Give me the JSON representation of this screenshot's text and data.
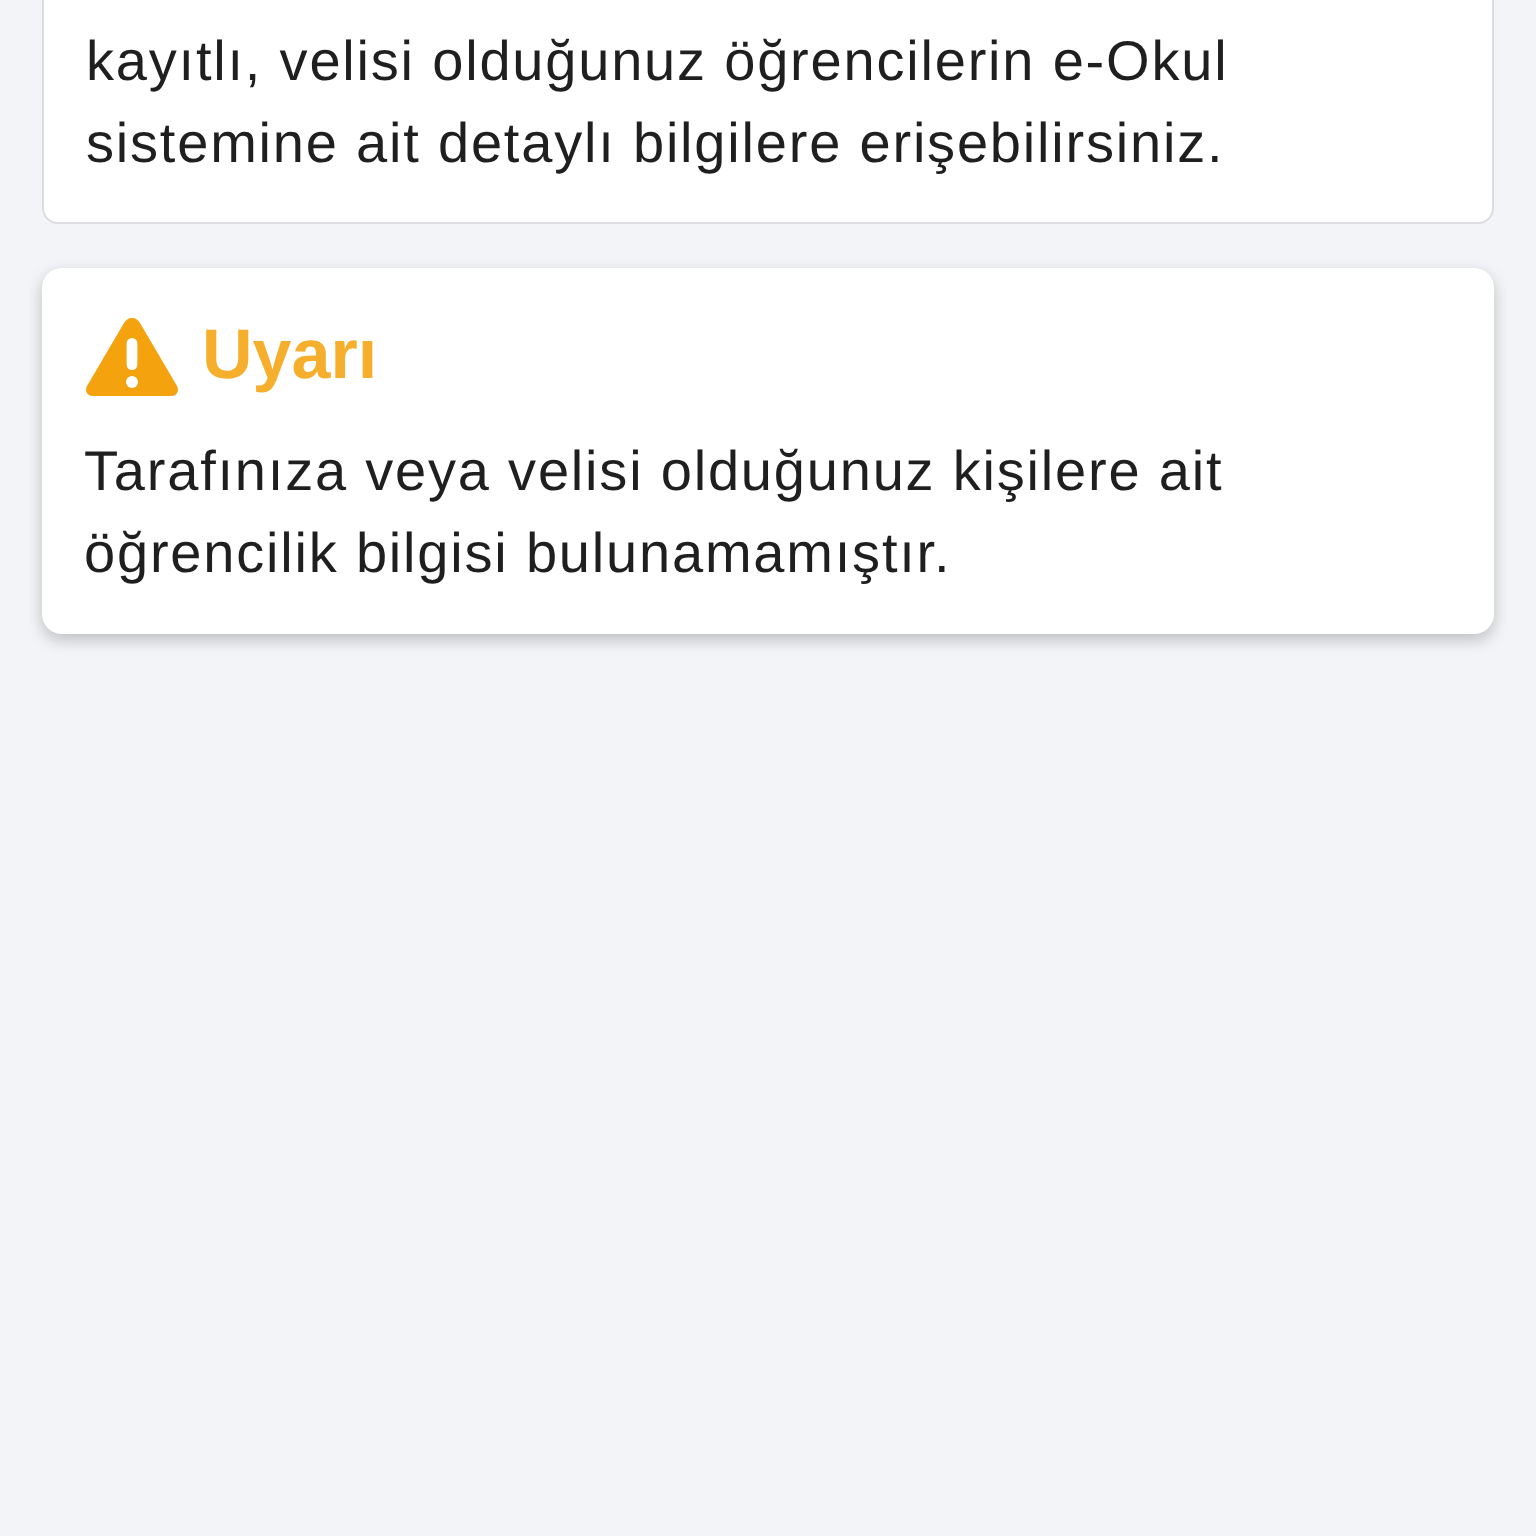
{
  "info_card": {
    "text": "kayıtlı, velisi olduğunuz öğrencilerin e-Okul sistemine ait detaylı bilgilere erişebilirsiniz."
  },
  "warning_card": {
    "title": "Uyarı",
    "message": "Tarafınıza veya velisi olduğunuz kişilere ait öğrencilik bilgisi bulunamamıştır."
  }
}
